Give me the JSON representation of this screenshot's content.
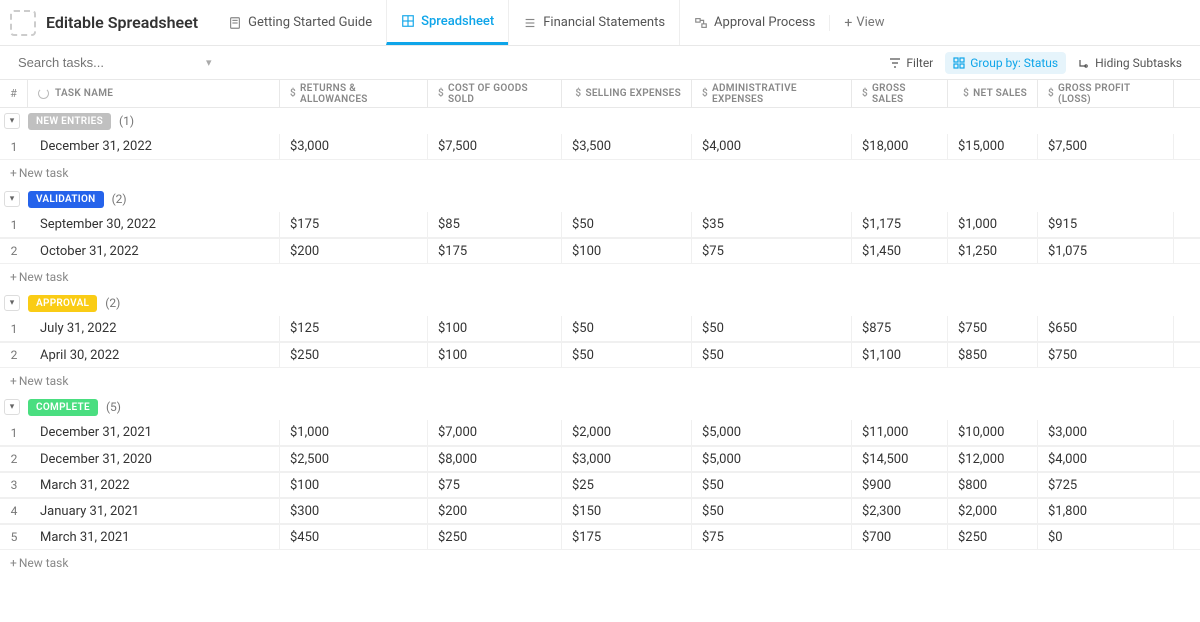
{
  "header": {
    "app_title": "Editable Spreadsheet",
    "tabs": [
      {
        "label": "Getting Started Guide",
        "active": false
      },
      {
        "label": "Spreadsheet",
        "active": true
      },
      {
        "label": "Financial Statements",
        "active": false
      },
      {
        "label": "Approval Process",
        "active": false
      }
    ],
    "view_btn": "View"
  },
  "toolbar": {
    "search_placeholder": "Search tasks...",
    "filter": "Filter",
    "group_by": "Group by: Status",
    "hiding": "Hiding Subtasks"
  },
  "columns": {
    "num": "#",
    "task": "TASK NAME",
    "c1": "RETURNS & ALLOWANCES",
    "c2": "COST OF GOODS SOLD",
    "c3": "SELLING EXPENSES",
    "c4": "ADMINISTRATIVE EXPENSES",
    "c5": "GROSS SALES",
    "c6": "NET SALES",
    "c7": "GROSS PROFIT (LOSS)"
  },
  "groups": [
    {
      "label": "NEW ENTRIES",
      "badge_class": "badge-gray",
      "count": "(1)",
      "rows": [
        {
          "n": "1",
          "task": "December 31, 2022",
          "c1": "$3,000",
          "c2": "$7,500",
          "c3": "$3,500",
          "c4": "$4,000",
          "c5": "$18,000",
          "c6": "$15,000",
          "c7": "$7,500"
        }
      ]
    },
    {
      "label": "VALIDATION",
      "badge_class": "badge-blue",
      "count": "(2)",
      "rows": [
        {
          "n": "1",
          "task": "September 30, 2022",
          "c1": "$175",
          "c2": "$85",
          "c3": "$50",
          "c4": "$35",
          "c5": "$1,175",
          "c6": "$1,000",
          "c7": "$915"
        },
        {
          "n": "2",
          "task": "October 31, 2022",
          "c1": "$200",
          "c2": "$175",
          "c3": "$100",
          "c4": "$75",
          "c5": "$1,450",
          "c6": "$1,250",
          "c7": "$1,075"
        }
      ]
    },
    {
      "label": "APPROVAL",
      "badge_class": "badge-yellow",
      "count": "(2)",
      "rows": [
        {
          "n": "1",
          "task": "July 31, 2022",
          "c1": "$125",
          "c2": "$100",
          "c3": "$50",
          "c4": "$50",
          "c5": "$875",
          "c6": "$750",
          "c7": "$650"
        },
        {
          "n": "2",
          "task": "April 30, 2022",
          "c1": "$250",
          "c2": "$100",
          "c3": "$50",
          "c4": "$50",
          "c5": "$1,100",
          "c6": "$850",
          "c7": "$750"
        }
      ]
    },
    {
      "label": "COMPLETE",
      "badge_class": "badge-green",
      "count": "(5)",
      "rows": [
        {
          "n": "1",
          "task": "December 31, 2021",
          "c1": "$1,000",
          "c2": "$7,000",
          "c3": "$2,000",
          "c4": "$5,000",
          "c5": "$11,000",
          "c6": "$10,000",
          "c7": "$3,000"
        },
        {
          "n": "2",
          "task": "December 31, 2020",
          "c1": "$2,500",
          "c2": "$8,000",
          "c3": "$3,000",
          "c4": "$5,000",
          "c5": "$14,500",
          "c6": "$12,000",
          "c7": "$4,000"
        },
        {
          "n": "3",
          "task": "March 31, 2022",
          "c1": "$100",
          "c2": "$75",
          "c3": "$25",
          "c4": "$50",
          "c5": "$900",
          "c6": "$800",
          "c7": "$725"
        },
        {
          "n": "4",
          "task": "January 31, 2021",
          "c1": "$300",
          "c2": "$200",
          "c3": "$150",
          "c4": "$50",
          "c5": "$2,300",
          "c6": "$2,000",
          "c7": "$1,800"
        },
        {
          "n": "5",
          "task": "March 31, 2021",
          "c1": "$450",
          "c2": "$250",
          "c3": "$175",
          "c4": "$75",
          "c5": "$700",
          "c6": "$250",
          "c7": "$0"
        }
      ]
    }
  ],
  "new_task": "New task"
}
